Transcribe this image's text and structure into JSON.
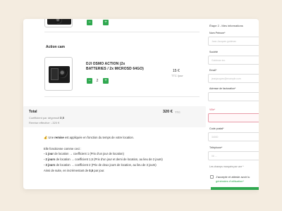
{
  "colors": {
    "accent": "#2fa84f",
    "background": "#f4ece0",
    "error_border": "#e89aa8"
  },
  "cart": {
    "qty_minus": "−",
    "qty_plus": "+",
    "section_title": "Action cam",
    "product": {
      "name_line1": "DJI OSMO ACTION (2x",
      "name_line2": "BATTERIES / 2x MICROSD 64GO)",
      "quantity": "2",
      "price": "15 €",
      "price_sub": "TTC /jour"
    },
    "total": {
      "label": "Total",
      "amount": "320 €",
      "amount_suffix": "TTC",
      "coef_label": "Coefficient par dégressif :",
      "coef_value": "3,5",
      "remise_label": "Remise effective :",
      "remise_value": "-320 €"
    },
    "info": {
      "emoji": "💰",
      "line1_prefix": "Une",
      "line1_bold": "remise",
      "line1_suffix": "est appliquée en fonction du temps de votre location.",
      "line2": "Elle fonctionne comme ceci :",
      "rule1_bold": "- 1 jour",
      "rule1_text": "de location → coefficient 1 (Prix d'un jour de location)",
      "rule2_bold": "- 2 jours",
      "rule2_text": "de location → coefficient 1,5 (Prix d'un jour et demi de location, au lieu de 2 jours)",
      "rule3_bold": "- 3 jours",
      "rule3_text": "de location → coefficient 2 (Prix de deux jours de location, au lieu de 3 jours)",
      "line_last_prefix": "Ainsi de suite, en incrémentant de",
      "line_last_bold": "0,5",
      "line_last_suffix": "par jour."
    }
  },
  "form": {
    "step_title": "Étape 2 - Mes informations",
    "fields": [
      {
        "label": "Nom Prénom*",
        "placeholder": "Jean-Jacques goldman"
      },
      {
        "label": "Société",
        "placeholder": "Goldman inc."
      },
      {
        "label": "Email*",
        "placeholder": "jeanjacques@example.com"
      },
      {
        "label": "Adresse de facturation*",
        "placeholder": ""
      },
      {
        "label": "Ville*",
        "placeholder": ""
      },
      {
        "label": "Code postal*",
        "placeholder": "34000"
      },
      {
        "label": "Téléphone*",
        "placeholder": "06 ..."
      }
    ],
    "consent_text": "J'accepte et atteste avoir lu",
    "consent_link": "générales d'utilisation*",
    "extra_label": "Les champs marqués par une *"
  }
}
